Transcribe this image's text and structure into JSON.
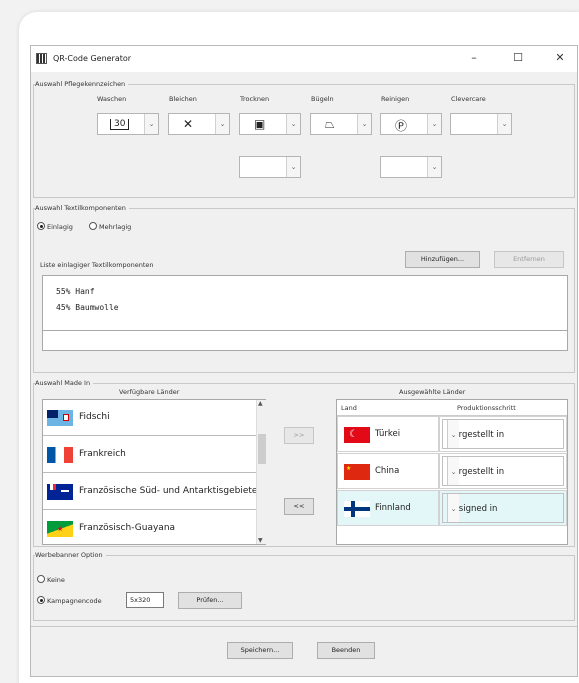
{
  "window": {
    "title": "QR-Code Generator",
    "minimize": "–",
    "maximize": "☐",
    "close": "✕"
  },
  "care": {
    "group_label": "Auswahl Pflegekennzeichen",
    "columns": [
      {
        "label": "Waschen",
        "symbol": "30"
      },
      {
        "label": "Bleichen",
        "symbol": "✕"
      },
      {
        "label": "Trocknen",
        "symbol": "▣"
      },
      {
        "label": "Bügeln",
        "symbol": "⏢"
      },
      {
        "label": "Reinigen",
        "symbol": "Ⓟ"
      },
      {
        "label": "Clevercare",
        "symbol": ""
      }
    ]
  },
  "textile": {
    "group_label": "Auswahl Textilkomponenten",
    "radio_single": "Einlagig",
    "radio_multi": "Mehrlagig",
    "list_label": "Liste einlagiger Textilkomponenten",
    "add_button": "Hinzufügen...",
    "remove_button": "Entfernen",
    "components": [
      "55% Hanf",
      "45% Baumwolle"
    ]
  },
  "madein": {
    "group_label": "Auswahl Made In",
    "available_label": "Verfügbare Länder",
    "selected_label": "Ausgewählte Länder",
    "available": [
      "Fidschi",
      "Frankreich",
      "Französische Süd- und Antarktisgebiete",
      "Französisch-Guayana"
    ],
    "move_right": ">>",
    "move_left": "<<",
    "table_headers": [
      "Land",
      "Produktionsschritt"
    ],
    "selected": [
      {
        "country": "Türkei",
        "step": "Hergestellt in"
      },
      {
        "country": "China",
        "step": "Hergestellt in"
      },
      {
        "country": "Finnland",
        "step": "Designed in"
      }
    ]
  },
  "ad": {
    "group_label": "Werbebanner Option",
    "none": "Keine",
    "campaign": "Kampagnencode",
    "code": "5x320",
    "check_button": "Prüfen..."
  },
  "footer": {
    "save": "Speichern...",
    "quit": "Beenden"
  }
}
